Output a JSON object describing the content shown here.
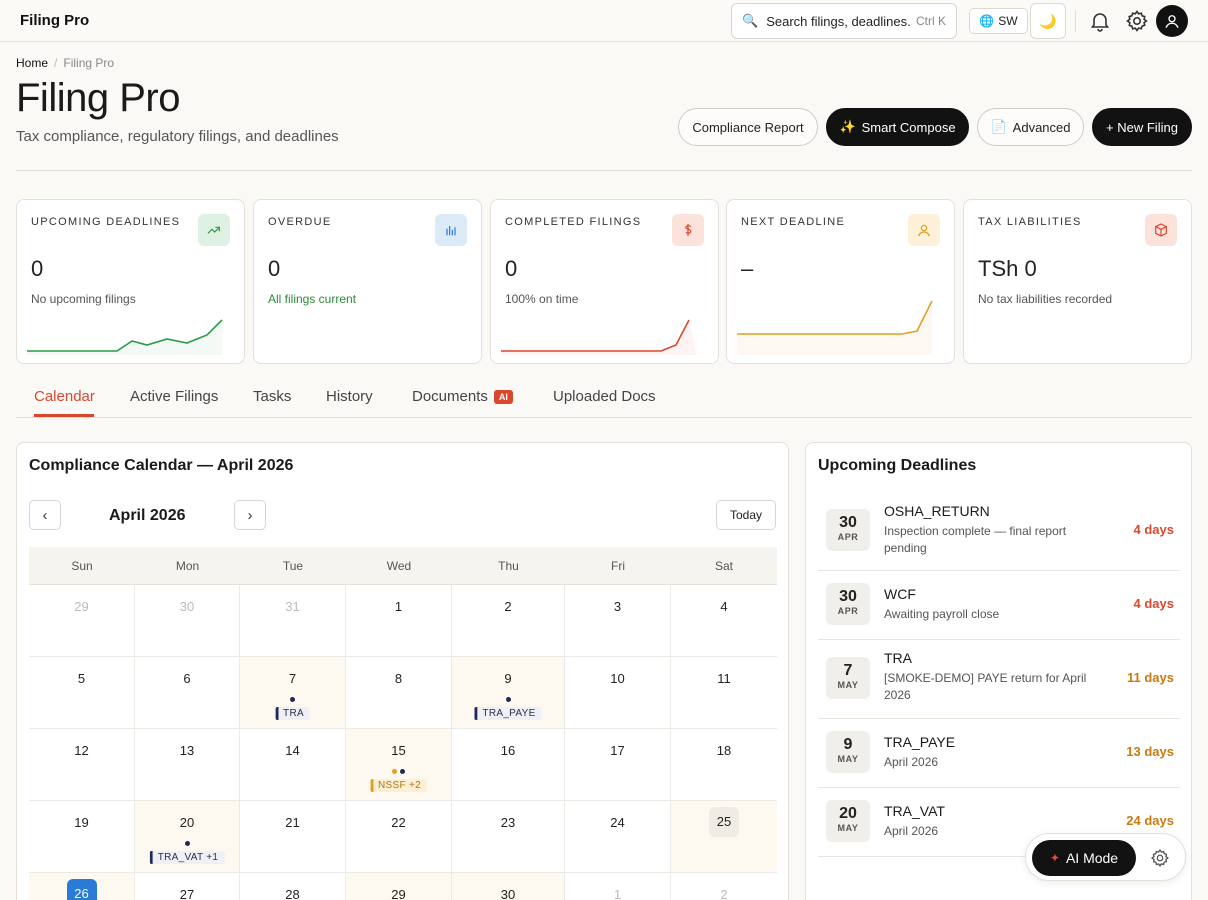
{
  "app": {
    "brand": "Filing Pro"
  },
  "topbar": {
    "search_placeholder": "Search filings, deadlines...",
    "search_shortcut": "Ctrl K",
    "language": "SW"
  },
  "breadcrumb": {
    "home": "Home",
    "current": "Filing Pro"
  },
  "header": {
    "title": "Filing Pro",
    "subtitle": "Tax compliance, regulatory filings, and deadlines",
    "buttons": {
      "compliance_report": "Compliance Report",
      "smart_compose": "Smart Compose",
      "advanced": "Advanced",
      "new_filing": "+ New Filing"
    }
  },
  "stats": [
    {
      "label": "Upcoming Deadlines",
      "value": "0",
      "sub": "No upcoming filings",
      "color": "#2c9a4a",
      "icon": "trending-up-icon"
    },
    {
      "label": "Overdue",
      "value": "0",
      "sub": "All filings current",
      "color": "#2a7bd6",
      "icon": "bar-chart-icon"
    },
    {
      "label": "Completed Filings",
      "value": "0",
      "sub": "100% on time",
      "color": "#d9482e",
      "icon": "dollar-icon"
    },
    {
      "label": "Next Deadline",
      "value": "–",
      "sub": "",
      "color": "#e0a020",
      "icon": "user-icon"
    },
    {
      "label": "Tax Liabilities",
      "value": "TSh 0",
      "sub": "No tax liabilities recorded",
      "color": "#d9482e",
      "icon": "box-icon"
    }
  ],
  "tabs": [
    {
      "label": "Calendar",
      "active": true
    },
    {
      "label": "Active Filings"
    },
    {
      "label": "Tasks"
    },
    {
      "label": "History"
    },
    {
      "label": "Documents",
      "badge": "AI"
    },
    {
      "label": "Uploaded Docs"
    }
  ],
  "calendar": {
    "title": "Compliance Calendar — April 2026",
    "month_label": "April 2026",
    "prev": "‹",
    "next": "›",
    "today_label": "Today",
    "weekdays": [
      "Sun",
      "Mon",
      "Tue",
      "Wed",
      "Thu",
      "Fri",
      "Sat"
    ],
    "weeks": [
      [
        {
          "n": "29",
          "muted": true
        },
        {
          "n": "30",
          "muted": true
        },
        {
          "n": "31",
          "muted": true
        },
        {
          "n": "1"
        },
        {
          "n": "2"
        },
        {
          "n": "3"
        },
        {
          "n": "4"
        }
      ],
      [
        {
          "n": "5"
        },
        {
          "n": "6"
        },
        {
          "n": "7",
          "tint": true,
          "dots": [
            "#1f2a5a"
          ],
          "tag": "TRA",
          "tagColor": "navy"
        },
        {
          "n": "8"
        },
        {
          "n": "9",
          "tint": true,
          "dots": [
            "#1f2a5a"
          ],
          "tag": "TRA_PAYE",
          "tagColor": "navy"
        },
        {
          "n": "10"
        },
        {
          "n": "11"
        }
      ],
      [
        {
          "n": "12"
        },
        {
          "n": "13"
        },
        {
          "n": "14"
        },
        {
          "n": "15",
          "tint": true,
          "dots": [
            "#e0a020",
            "#1f2a5a"
          ],
          "tag": "NSSF +2",
          "tagColor": "amber"
        },
        {
          "n": "16"
        },
        {
          "n": "17"
        },
        {
          "n": "18"
        }
      ],
      [
        {
          "n": "19"
        },
        {
          "n": "20",
          "tint": true,
          "dots": [
            "#1f2a5a"
          ],
          "tag": "TRA_VAT +1",
          "tagColor": "navy"
        },
        {
          "n": "21"
        },
        {
          "n": "22"
        },
        {
          "n": "23"
        },
        {
          "n": "24"
        },
        {
          "n": "25",
          "sel": true,
          "tint": true
        }
      ],
      [
        {
          "n": "26",
          "today": true,
          "tint": true
        },
        {
          "n": "27"
        },
        {
          "n": "28"
        },
        {
          "n": "29",
          "tint": true
        },
        {
          "n": "30",
          "tint": true
        },
        {
          "n": "1",
          "muted": true
        },
        {
          "n": "2",
          "muted": true
        }
      ]
    ]
  },
  "upcoming": {
    "title": "Upcoming Deadlines",
    "items": [
      {
        "day": "30",
        "month": "Apr",
        "name": "OSHA_RETURN",
        "desc": "Inspection complete — final report pending",
        "days": "4 days",
        "urgent": true
      },
      {
        "day": "30",
        "month": "Apr",
        "name": "WCF",
        "desc": "Awaiting payroll close",
        "days": "4 days",
        "urgent": true
      },
      {
        "day": "7",
        "month": "May",
        "name": "TRA",
        "desc": "[SMOKE-DEMO] PAYE return for April 2026",
        "days": "11 days"
      },
      {
        "day": "9",
        "month": "May",
        "name": "TRA_PAYE",
        "desc": "April 2026",
        "days": "13 days"
      },
      {
        "day": "20",
        "month": "May",
        "name": "TRA_VAT",
        "desc": "April 2026",
        "days": "24 days"
      }
    ]
  },
  "ai_mode": {
    "label": "AI Mode"
  }
}
